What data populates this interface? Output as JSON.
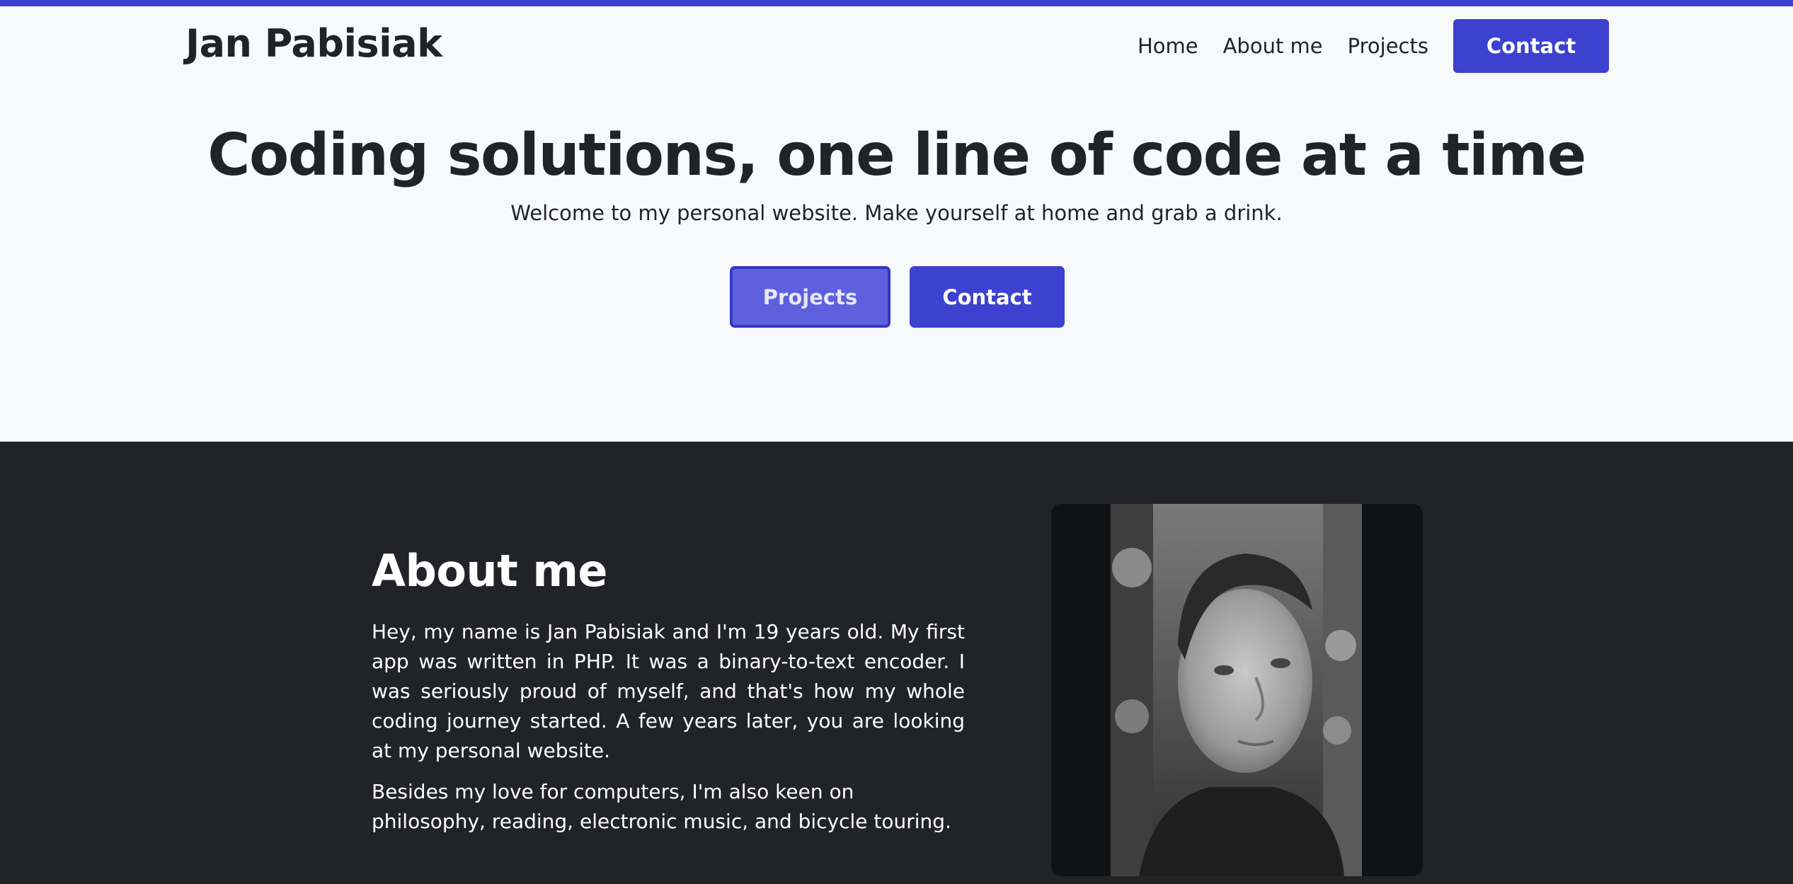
{
  "header": {
    "brand": "Jan Pabisiak",
    "nav": [
      {
        "label": "Home"
      },
      {
        "label": "About me"
      },
      {
        "label": "Projects"
      }
    ],
    "contact_label": "Contact"
  },
  "hero": {
    "title": "Coding solutions, one line of code at a time",
    "subtitle": "Welcome to my personal website. Make yourself at home and grab a drink.",
    "projects_label": "Projects",
    "contact_label": "Contact"
  },
  "about": {
    "title": "About me",
    "paragraph1": "Hey, my name is Jan Pabisiak and I'm 19 years old. My first app was written in PHP. It was a binary-to-text encoder. I was seriously proud of myself, and that's how my whole coding journey started. A few years later, you are looking at my personal website.",
    "paragraph2": "Besides my love for computers, I'm also keen on philosophy, reading, electronic music, and bicycle touring."
  },
  "colors": {
    "accent": "#3d41cf",
    "dark_section": "#212327",
    "page_bg": "#f8f9fb"
  }
}
